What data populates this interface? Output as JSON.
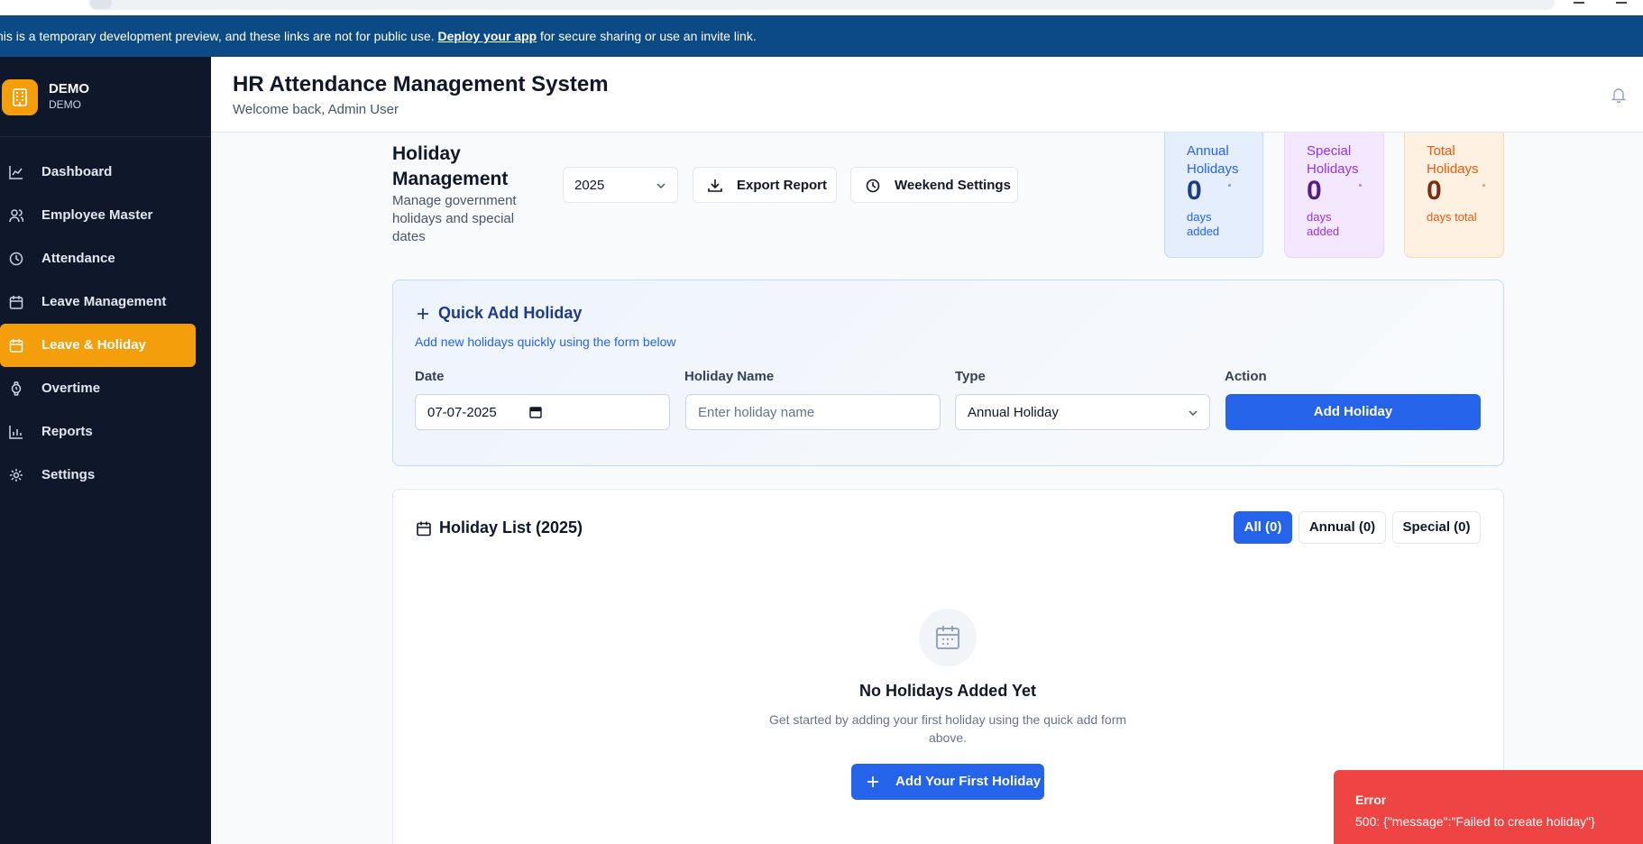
{
  "banner": {
    "text_before": "his is a temporary development preview, and these links are not for public use. ",
    "link": "Deploy your app",
    "text_after": " for secure sharing or use an invite link."
  },
  "brand": {
    "name": "DEMO",
    "sub": "DEMO"
  },
  "sidebar": {
    "items": [
      {
        "label": "Dashboard",
        "icon": "chart-line-icon"
      },
      {
        "label": "Employee Master",
        "icon": "users-icon"
      },
      {
        "label": "Attendance",
        "icon": "clock-icon"
      },
      {
        "label": "Leave Management",
        "icon": "calendar-icon"
      },
      {
        "label": "Leave & Holiday",
        "icon": "calendar-icon",
        "active": true
      },
      {
        "label": "Overtime",
        "icon": "watch-icon"
      },
      {
        "label": "Reports",
        "icon": "bar-chart-icon"
      },
      {
        "label": "Settings",
        "icon": "gear-icon"
      }
    ]
  },
  "header": {
    "title": "HR Attendance Management System",
    "subtitle": "Welcome back, Admin User"
  },
  "holiday": {
    "title": "Holiday Management",
    "subtitle": "Manage government holidays and special dates",
    "year": "2025",
    "export_label": "Export Report",
    "weekend_label": "Weekend Settings"
  },
  "stats": {
    "annual": {
      "label": "Annual Holidays",
      "value": "0",
      "sub": "days added"
    },
    "special": {
      "label": "Special Holidays",
      "value": "0",
      "sub": "days added"
    },
    "total": {
      "label": "Total Holidays",
      "value": "0",
      "sub": "days total"
    }
  },
  "quick_add": {
    "title": "Quick Add Holiday",
    "subtitle": "Add new holidays quickly using the form below",
    "date_label": "Date",
    "date_value": "07-07-2025",
    "name_label": "Holiday Name",
    "name_placeholder": "Enter holiday name",
    "type_label": "Type",
    "type_value": "Annual Holiday",
    "action_label": "Action",
    "add_button": "Add Holiday"
  },
  "holiday_list": {
    "title": "Holiday List (2025)",
    "filters": {
      "all": "All (0)",
      "annual": "Annual (0)",
      "special": "Special (0)"
    },
    "empty_title": "No Holidays Added Yet",
    "empty_sub": "Get started by adding your first holiday using the quick add form above.",
    "empty_button": "Add Your First Holiday"
  },
  "toast": {
    "title": "Error",
    "message": "500: {\"message\":\"Failed to create holiday\"}"
  },
  "colors": {
    "brand_accent": "#f59e0b",
    "primary": "#2563eb",
    "banner": "#0b4a85",
    "sidebar": "#0f172a",
    "error": "#ef4444"
  }
}
